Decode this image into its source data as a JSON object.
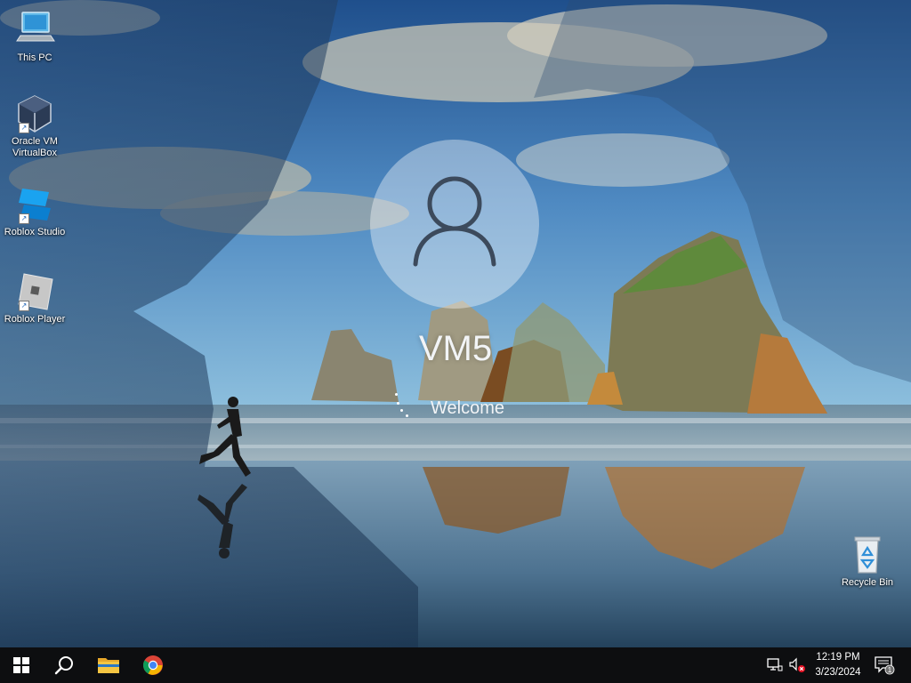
{
  "desktop": {
    "icons": [
      {
        "label_lines": [
          "This PC"
        ],
        "icon": "computer-icon"
      },
      {
        "label_lines": [
          "Oracle VM",
          "VirtualBox"
        ],
        "icon": "virtualbox-icon"
      },
      {
        "label_lines": [
          "Roblox Studio"
        ],
        "icon": "roblox-studio-icon"
      },
      {
        "label_lines": [
          "Roblox Player"
        ],
        "icon": "roblox-player-icon"
      },
      {
        "label_lines": [
          "Recycle Bin"
        ],
        "icon": "recycle-bin-icon"
      }
    ]
  },
  "login": {
    "username": "VM5",
    "status": "Welcome",
    "avatar_icon": "user-icon"
  },
  "taskbar": {
    "start_icon": "windows-start-icon",
    "search_icon": "search-icon",
    "pinned": [
      {
        "icon": "file-explorer-icon"
      },
      {
        "icon": "chrome-icon"
      }
    ],
    "tray": {
      "network_icon": "network-icon",
      "volume_icon": "volume-muted-icon",
      "time": "12:19 PM",
      "date": "3/23/2024",
      "notifications_icon": "notification-icon",
      "notifications_count": "1"
    }
  },
  "colors": {
    "taskbar_bg": "#0d0e10",
    "windows_blue": "#1e90ff",
    "chrome_red": "#db4437",
    "chrome_yellow": "#f4b400",
    "chrome_green": "#0f9d58",
    "chrome_blue": "#4285f4",
    "mute_red": "#e81123"
  }
}
